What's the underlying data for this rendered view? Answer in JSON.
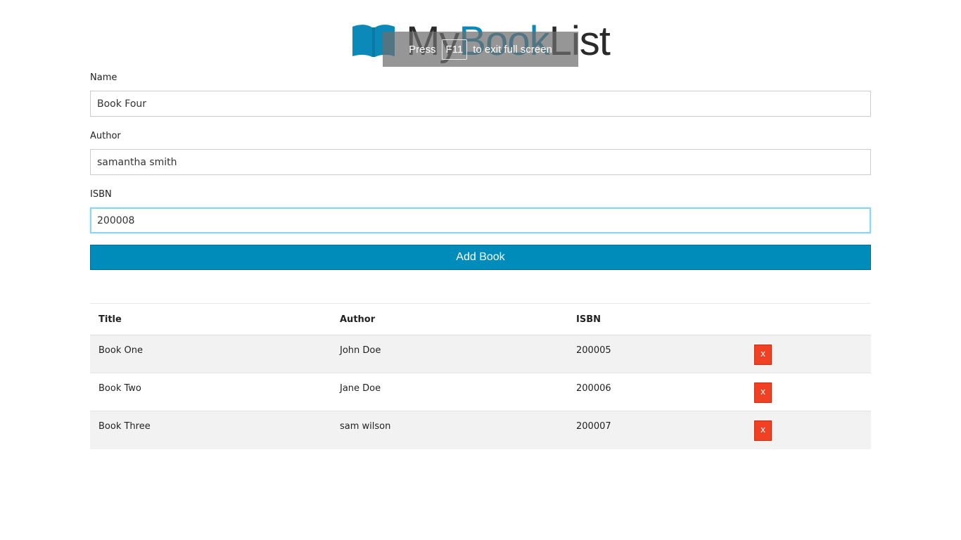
{
  "header": {
    "logo_my": "My",
    "logo_book": "Book",
    "logo_list": "List",
    "logo_icon": "open-book-icon"
  },
  "fullscreen_notice": {
    "press": "Press",
    "key": "F11",
    "message": "to exit full screen"
  },
  "form": {
    "name_label": "Name",
    "name_value": "Book Four",
    "author_label": "Author",
    "author_value": "samantha smith",
    "isbn_label": "ISBN",
    "isbn_value": "200008",
    "submit_label": "Add Book"
  },
  "table": {
    "headers": [
      "Title",
      "Author",
      "ISBN",
      ""
    ],
    "rows": [
      {
        "title": "Book One",
        "author": "John Doe",
        "isbn": "200005",
        "delete_label": "x"
      },
      {
        "title": "Book Two",
        "author": "Jane Doe",
        "isbn": "200006",
        "delete_label": "x"
      },
      {
        "title": "Book Three",
        "author": "sam wilson",
        "isbn": "200007",
        "delete_label": "x"
      }
    ]
  },
  "colors": {
    "brand_blue": "#008cba",
    "logo_blue": "#0b8ab9",
    "delete_red": "#f04124"
  }
}
